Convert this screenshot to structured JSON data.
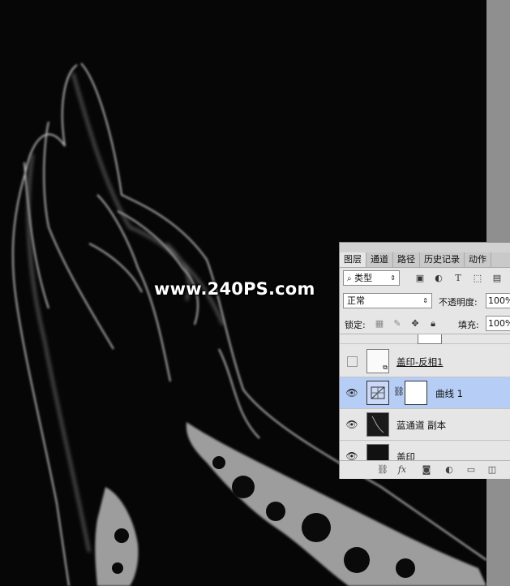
{
  "watermark": "www.240PS.com",
  "layers_panel": {
    "tabs": [
      "图层",
      "通道",
      "路径",
      "历史记录",
      "动作"
    ],
    "active_tab": "图层",
    "filter": {
      "label": "类型",
      "icon": "search-icon"
    },
    "filter_icons": [
      "image-filter-icon",
      "adjustment-filter-icon",
      "type-filter-icon",
      "shape-filter-icon",
      "smart-object-filter-icon"
    ],
    "filter_type_glyph": "T",
    "blend_mode": "正常",
    "opacity_label": "不透明度:",
    "opacity_value": "100%",
    "lock_label": "锁定:",
    "fill_label": "填充:",
    "fill_value": "100%",
    "layers": [
      {
        "name": "盖印-反相1",
        "visible": false,
        "selected": false
      },
      {
        "name": "曲线 1",
        "visible": true,
        "selected": true
      },
      {
        "name": "蓝通道 副本",
        "visible": true,
        "selected": false
      },
      {
        "name": "盖印",
        "visible": true,
        "selected": false
      }
    ],
    "bottom_icons": [
      "link-icon",
      "fx-icon",
      "mask-icon",
      "adjustment-icon",
      "folder-icon",
      "new-layer-icon"
    ],
    "fx_label": "fx",
    "colors": {
      "selected_row": "#b6cdf5",
      "panel_bg": "#e6e6e6",
      "tab_bar": "#c9c9c9"
    }
  }
}
